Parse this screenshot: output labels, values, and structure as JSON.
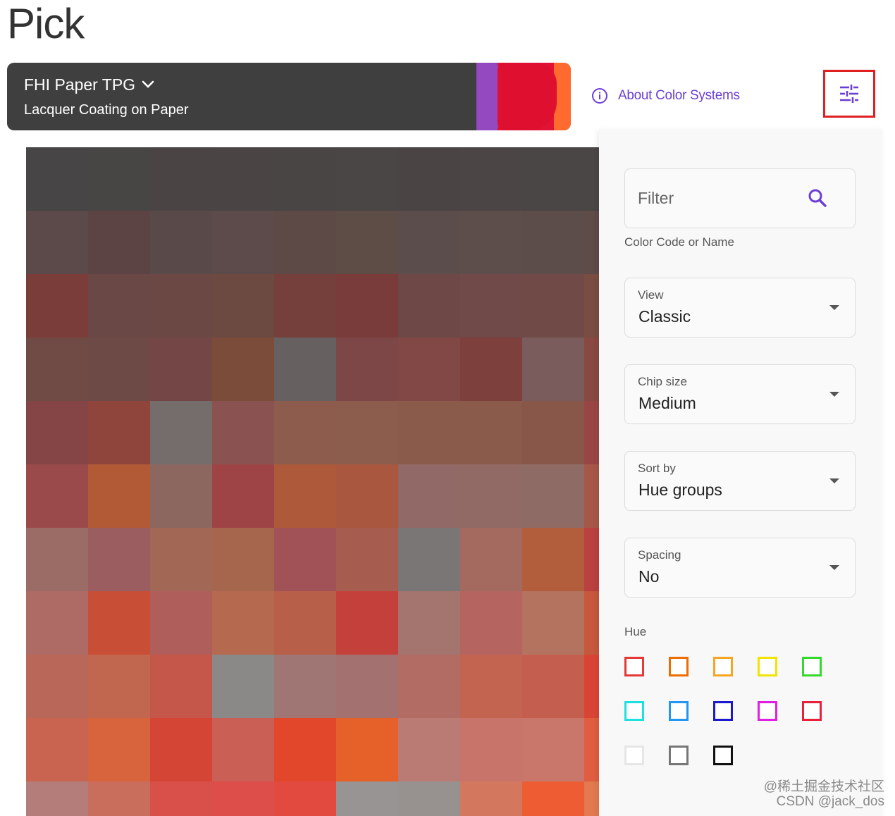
{
  "page": {
    "title": "Pick"
  },
  "system": {
    "name": "FHI Paper TPG",
    "subtitle": "Lacquer Coating on Paper"
  },
  "about_link": {
    "label": "About Color Systems",
    "icon": "info-icon"
  },
  "filter_toggle": {
    "icon": "tune-sliders-icon",
    "highlight_color": "#e02020"
  },
  "panel": {
    "filter": {
      "placeholder": "Filter",
      "helper": "Color Code or Name",
      "icon": "search-icon"
    },
    "selects": [
      {
        "label": "View",
        "value": "Classic"
      },
      {
        "label": "Chip size",
        "value": "Medium"
      },
      {
        "label": "Sort by",
        "value": "Hue groups"
      },
      {
        "label": "Spacing",
        "value": "No"
      }
    ],
    "hue_label": "Hue",
    "hues": [
      "#e53935",
      "#ef6c00",
      "#f5a623",
      "#f0e400",
      "#34d92c",
      "#1ee0e0",
      "#2196f3",
      "#1a1acc",
      "#e020e0",
      "#e8203a",
      "#e6e6e6",
      "#777777",
      "#111111"
    ]
  },
  "color_grid": [
    [
      "#474545",
      "#484545",
      "#4a4444",
      "#4a4544",
      "#4a4545",
      "#4b4646",
      "#4a4444",
      "#4b4545",
      "#4b4646",
      "#4b4646"
    ],
    [
      "#5b4a49",
      "#5d4444",
      "#5a4949",
      "#5d4a4a",
      "#5d4a47",
      "#5e4c46",
      "#5a4d4b",
      "#5d4e4c",
      "#5c4c4a",
      "#5f4b47"
    ],
    [
      "#7a3d39",
      "#6a4845",
      "#6b4844",
      "#6c4941",
      "#753f3b",
      "#7a3b3b",
      "#6e4747",
      "#704a48",
      "#6f4a46",
      "#7a4d42"
    ],
    [
      "#704a45",
      "#6e4a46",
      "#744746",
      "#7c4c3b",
      "#676060",
      "#7c4746",
      "#814845",
      "#7e403d",
      "#7a5c5c",
      "#894842"
    ],
    [
      "#854547",
      "#8f443c",
      "#756d6b",
      "#8a5352",
      "#8d5c4c",
      "#8c5d4d",
      "#8a5b4b",
      "#8a5a4b",
      "#895749",
      "#9a4545"
    ],
    [
      "#9a4a4a",
      "#b25a35",
      "#8c6760",
      "#9e4446",
      "#ae5a3a",
      "#a9573e",
      "#916966",
      "#916a66",
      "#8e6b65",
      "#a55848"
    ],
    [
      "#9b6b65",
      "#9b5d60",
      "#a36855",
      "#a6664d",
      "#a05257",
      "#a65c4e",
      "#7b7676",
      "#a46a5f",
      "#b25e3d",
      "#bb4040"
    ],
    [
      "#ae6a64",
      "#c84f35",
      "#b05e5b",
      "#b56a50",
      "#b85f4a",
      "#c4403a",
      "#a4746e",
      "#b66460",
      "#b4735e",
      "#c6583e"
    ],
    [
      "#b96758",
      "#c1674f",
      "#c45749",
      "#8b8988",
      "#a07674",
      "#a3716f",
      "#b26c64",
      "#c26450",
      "#c45f50",
      "#d94535"
    ],
    [
      "#c8644f",
      "#d8643d",
      "#d44536",
      "#c95f55",
      "#e2472b",
      "#e6602a",
      "#ba7b75",
      "#c9746a",
      "#c9766b",
      "#e05d40"
    ],
    [
      "#b47d79",
      "#c96d5d",
      "#d9504a",
      "#dd4e4a",
      "#e24a3f",
      "#999494",
      "#979290",
      "#d4775f",
      "#ed5c33",
      "#e2794f"
    ]
  ],
  "watermark": {
    "line1": "@稀土掘金技术社区",
    "line2": "CSDN @jack_dos"
  }
}
